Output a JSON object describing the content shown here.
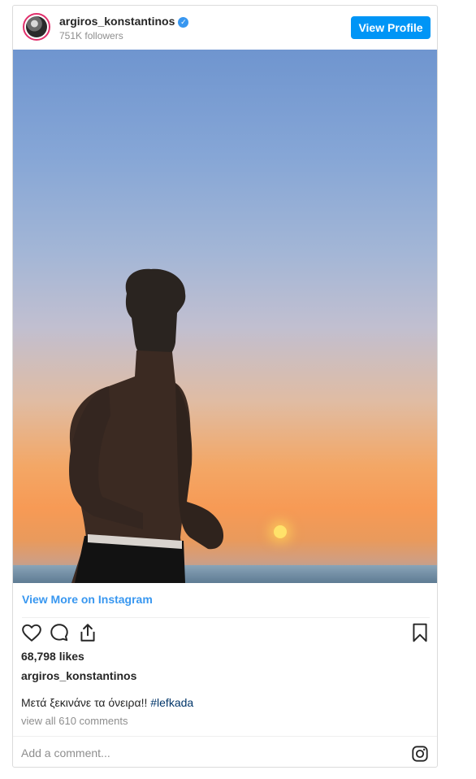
{
  "header": {
    "username": "argiros_konstantinos",
    "verified_mark": "✓",
    "followers": "751K followers",
    "view_profile_label": "View Profile"
  },
  "post": {
    "view_more_label": "View More on Instagram",
    "likes": "68,798 likes",
    "owner": "argiros_konstantinos",
    "caption_text": "Μετά ξεκινάνε τα όνειρα!! ",
    "hashtag": "#lefkada",
    "comments_link": "view all 610 comments"
  },
  "comment": {
    "placeholder": "Add a comment..."
  },
  "icons": {
    "like": "heart-icon",
    "comment": "comment-icon",
    "share": "share-icon",
    "save": "bookmark-icon",
    "instagram": "instagram-logo-icon"
  },
  "colors": {
    "accent": "#0095f6",
    "link": "#3897f0",
    "hashtag": "#003569",
    "muted": "#8e8e8e"
  }
}
